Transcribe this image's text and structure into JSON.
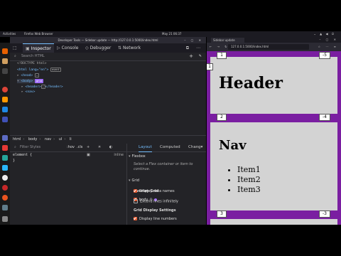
{
  "desktop": {
    "activities": "Activities",
    "app_name": "Firefox Web Browser",
    "clock": "May 21 06:37",
    "tray": "⌄ ▲ ◀ ⏻"
  },
  "devtools": {
    "window_title": "Developer Tools — Sidebar update — http://127.0.0.1:5000/index.html",
    "window_controls": "– ▢ ✕",
    "tabs": [
      {
        "label": "Inspector",
        "icon": "inspector-icon"
      },
      {
        "label": "Console",
        "icon": "console-icon"
      },
      {
        "label": "Debugger",
        "icon": "debugger-icon"
      },
      {
        "label": "Network",
        "icon": "network-icon"
      }
    ],
    "search_placeholder": "Search HTML",
    "markup": {
      "doctype": "<!DOCTYPE html>",
      "html_open": "<html lang=\"en\">",
      "head": "<head>",
      "body": "<body>",
      "header": "<header>",
      "header_close": "</header>",
      "nav": "<nav>",
      "event_badge": "event",
      "grid_badge": "grid",
      "ellipsis_badge": "…"
    },
    "breadcrumbs": [
      "html",
      "body",
      "nav",
      "ul",
      "li"
    ],
    "rules": {
      "filter_placeholder": "Filter Styles",
      "hov": ":hov",
      "cls": ".cls",
      "element_rule": "element {",
      "element_close": "}",
      "inline": "inline"
    },
    "layout": {
      "tabs": [
        "Layout",
        "Computed",
        "Chang▾"
      ],
      "flexbox_title": "Flexbox",
      "flexbox_hint": "Select a Flex container or item to continue.",
      "grid_title": "Grid",
      "overlay_grid": "Overlay Grid",
      "overlay_item": "body",
      "display_settings": "Grid Display Settings",
      "opt_line_numbers": "Display line numbers",
      "opt_area_names": "Display area names",
      "opt_extend_lines": "Extend lines infinitely",
      "opt_line_numbers_checked": true,
      "opt_area_names_checked": true,
      "opt_extend_lines_checked": false,
      "grid_color": "#9f6cf7"
    }
  },
  "browser": {
    "tab_title": "Sidebar update",
    "url": "127.0.0.1:5000/index.html",
    "page": {
      "header": "Header",
      "nav": "Nav",
      "items": [
        "Item1",
        "Item2",
        "Item3"
      ],
      "line_numbers": {
        "l1": "1",
        "r1": "-5",
        "l2": "2",
        "r2": "-4",
        "l3": "3",
        "r3": "-3",
        "side": "1"
      }
    }
  },
  "colors": {
    "accent": "#75bfff",
    "grid_bg": "#7a1ea1",
    "cell_bg": "#d3d3d3",
    "checkbox": "#e65b32"
  }
}
